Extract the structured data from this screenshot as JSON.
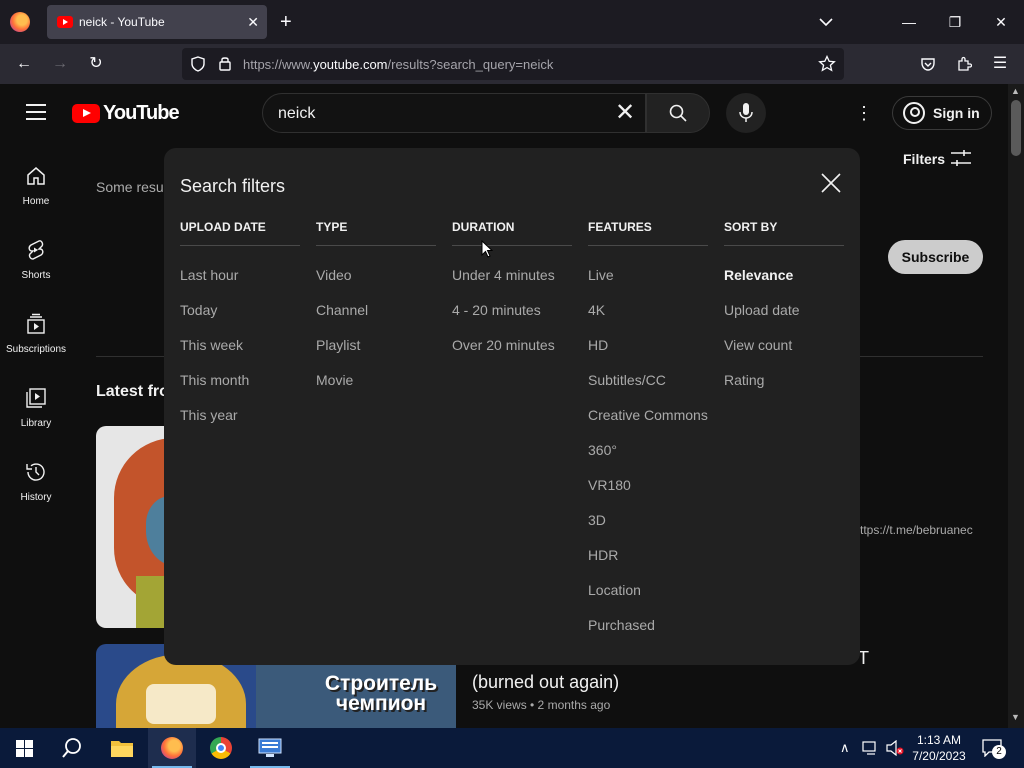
{
  "browser": {
    "tab_title": "neick - YouTube",
    "url_prefix": "https://www.",
    "url_domain": "youtube.com",
    "url_path": "/results?search_query=neick"
  },
  "youtube": {
    "logo_text": "YouTube",
    "search_value": "neick",
    "signin_label": "Sign in",
    "sidebar": [
      {
        "label": "Home",
        "icon": "home-icon"
      },
      {
        "label": "Shorts",
        "icon": "shorts-icon"
      },
      {
        "label": "Subscriptions",
        "icon": "subscriptions-icon"
      },
      {
        "label": "Library",
        "icon": "library-icon"
      },
      {
        "label": "History",
        "icon": "history-icon"
      }
    ],
    "background": {
      "filters_label": "Filters",
      "some_results": "Some resu",
      "subscribe_label": "Subscribe",
      "latest_from": "Latest fro",
      "channel_link": "ttps://t.me/bebruanec",
      "video2_title": "(burned out again)",
      "video2_title_tail": "T",
      "video2_meta": "35K views • 2 months ago",
      "thumb2_text": "Строитель чемпион"
    }
  },
  "filters_dialog": {
    "title": "Search filters",
    "columns": [
      {
        "heading": "UPLOAD DATE",
        "items": [
          "Last hour",
          "Today",
          "This week",
          "This month",
          "This year"
        ]
      },
      {
        "heading": "TYPE",
        "items": [
          "Video",
          "Channel",
          "Playlist",
          "Movie"
        ]
      },
      {
        "heading": "DURATION",
        "items": [
          "Under 4 minutes",
          "4 - 20 minutes",
          "Over 20 minutes"
        ]
      },
      {
        "heading": "FEATURES",
        "items": [
          "Live",
          "4K",
          "HD",
          "Subtitles/CC",
          "Creative Commons",
          "360°",
          "VR180",
          "3D",
          "HDR",
          "Location",
          "Purchased"
        ]
      },
      {
        "heading": "SORT BY",
        "items": [
          "Relevance",
          "Upload date",
          "View count",
          "Rating"
        ],
        "active": "Relevance"
      }
    ]
  },
  "taskbar": {
    "time": "1:13 AM",
    "date": "7/20/2023",
    "notification_count": "2"
  },
  "colors": {
    "yt_red": "#ff0000",
    "dialog_bg": "#212121",
    "page_bg": "#0f0f0f"
  }
}
